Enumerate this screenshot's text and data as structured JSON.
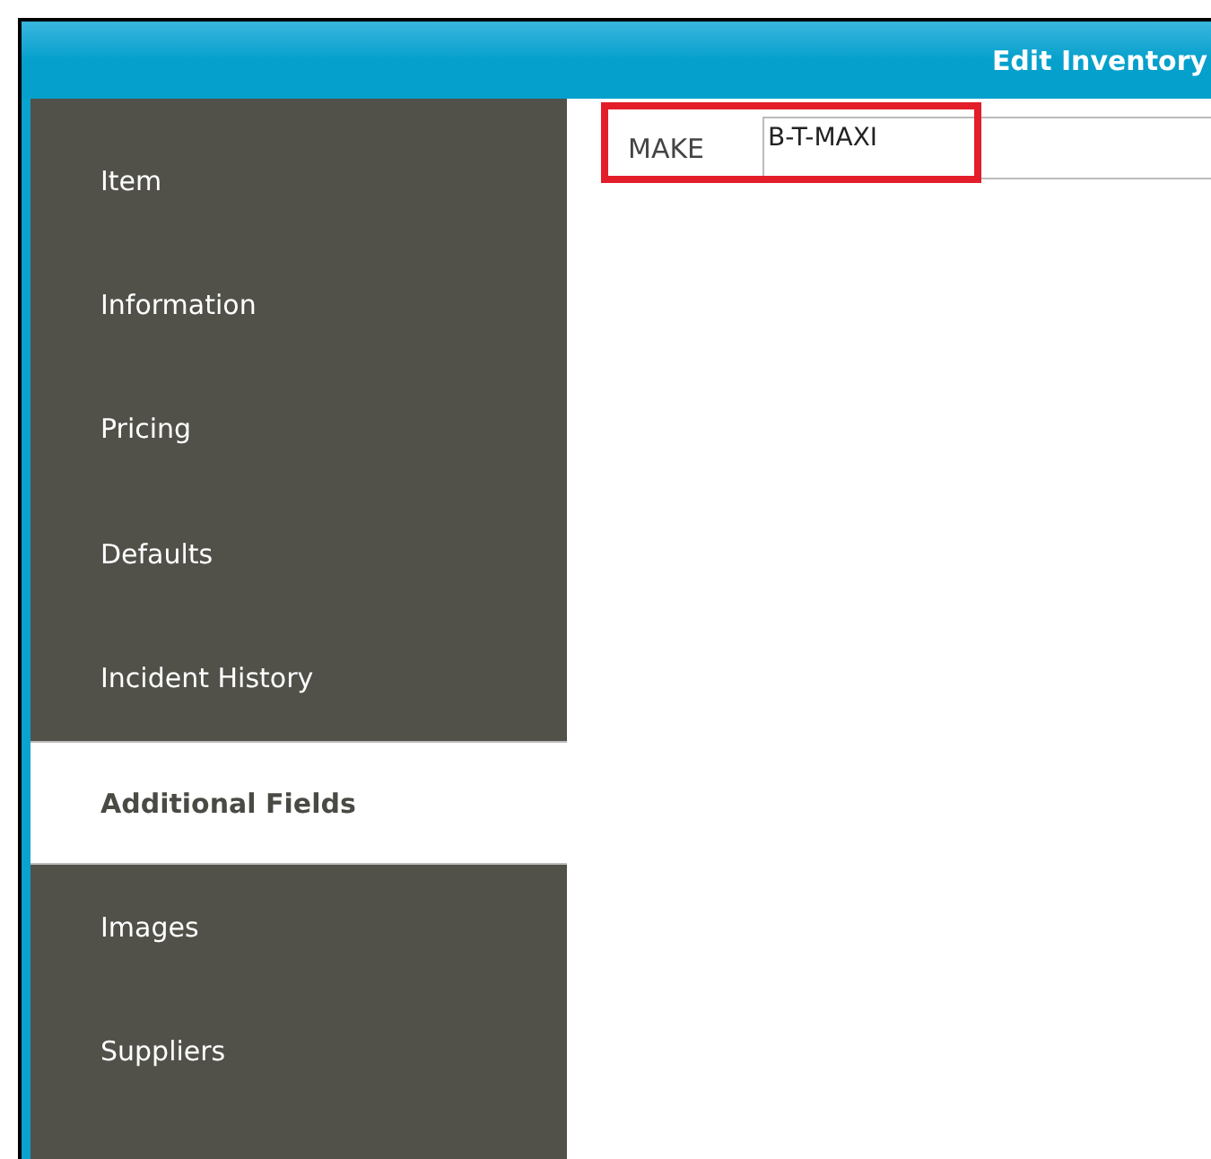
{
  "window": {
    "title": "Edit Inventory"
  },
  "sidebar": {
    "items": [
      {
        "label": "Item",
        "selected": false
      },
      {
        "label": "Information",
        "selected": false
      },
      {
        "label": "Pricing",
        "selected": false
      },
      {
        "label": "Defaults",
        "selected": false
      },
      {
        "label": "Incident History",
        "selected": false
      },
      {
        "label": "Additional Fields",
        "selected": true
      },
      {
        "label": "Images",
        "selected": false
      },
      {
        "label": "Suppliers",
        "selected": false
      }
    ]
  },
  "fields": [
    {
      "label": "MAKE",
      "value": "B-T-MAXI",
      "highlighted": true
    }
  ]
}
